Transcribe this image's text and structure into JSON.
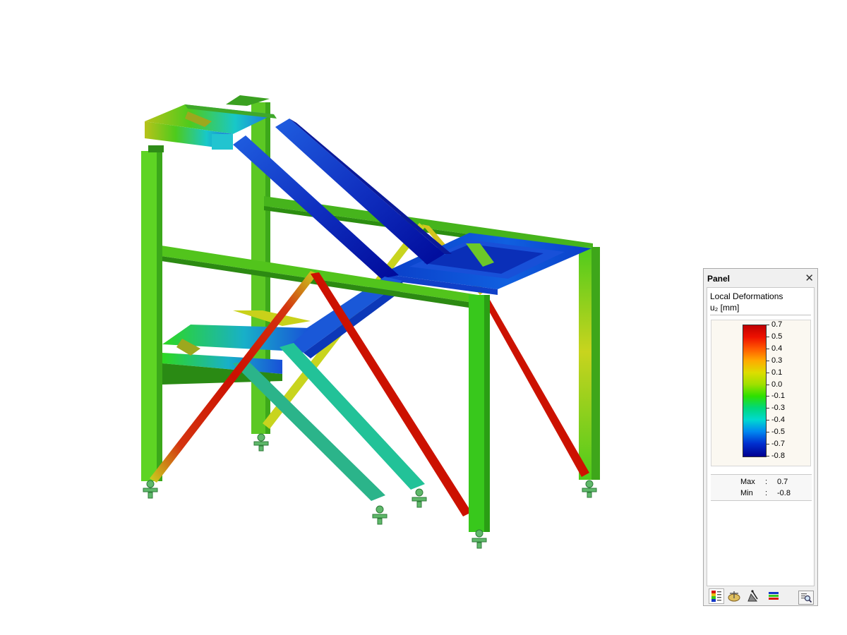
{
  "panel": {
    "title": "Panel",
    "close_glyph": "✕",
    "result_title": "Local Deformations",
    "result_unit": "u₂ [mm]",
    "legend": {
      "values": [
        "0.7",
        "0.5",
        "0.4",
        "0.3",
        "0.1",
        "0.0",
        "-0.1",
        "-0.3",
        "-0.4",
        "-0.5",
        "-0.7",
        "-0.8"
      ]
    },
    "max_label": "Max",
    "max_value": "0.7",
    "min_label": "Min",
    "min_value": "-0.8",
    "separator": ":",
    "icons": {
      "zoom": "magnifier-icon",
      "tabs": [
        "color-scale-icon",
        "balance-icon",
        "section-properties-icon",
        "layers-icon"
      ]
    }
  },
  "colors": {
    "green": "#4ecb1c",
    "blue": "#1338c8",
    "red": "#d81808",
    "yellow": "#c9d11a",
    "cyan": "#18c8c8",
    "teal": "#26b888"
  }
}
